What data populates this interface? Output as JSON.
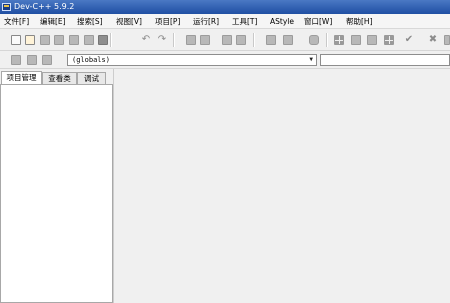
{
  "window": {
    "title": "Dev-C++ 5.9.2"
  },
  "menu": {
    "items": [
      "文件[F]",
      "编辑[E]",
      "搜索[S]",
      "视图[V]",
      "项目[P]",
      "运行[R]",
      "工具[T]",
      "AStyle",
      "窗口[W]",
      "帮助[H]"
    ]
  },
  "toolbar2": {
    "class_combo_value": "(globals)"
  },
  "left_panel": {
    "tabs": [
      "项目管理",
      "查看类",
      "调试"
    ]
  },
  "icons": {
    "undo": "undo-icon",
    "redo": "redo-icon",
    "check": "check-icon",
    "close": "close-icon"
  }
}
